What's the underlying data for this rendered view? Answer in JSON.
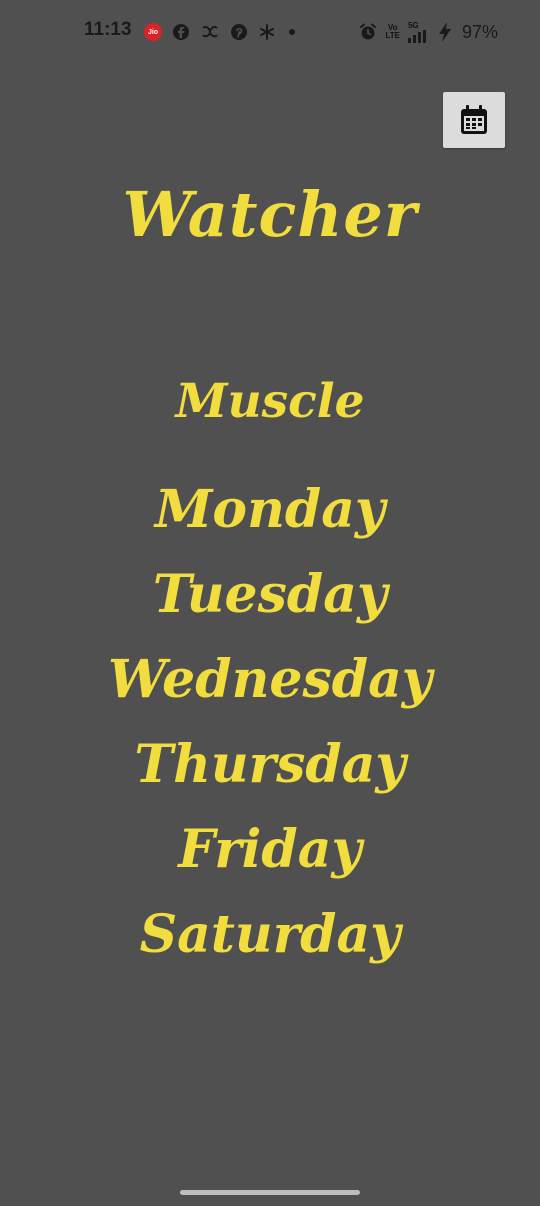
{
  "status_bar": {
    "time": "11:13",
    "jio_label": "Jio",
    "net_top": "Vo",
    "net_bottom": "LTE",
    "net_gen": "5G",
    "battery": "97%",
    "icons": [
      "jio-icon",
      "facebook-icon",
      "app-icon",
      "pinterest-icon",
      "spark-icon",
      "dot-icon",
      "alarm-icon",
      "volte-icon",
      "signal-icon",
      "charging-icon"
    ]
  },
  "toolbar": {
    "calendar_icon": "calendar-icon"
  },
  "app": {
    "title": "Watcher",
    "workout": "Muscle"
  },
  "days": [
    "Monday",
    "Tuesday",
    "Wednesday",
    "Thursday",
    "Friday",
    "Saturday"
  ],
  "colors": {
    "background": "#505050",
    "text_accent": "#f2dd3e",
    "button_bg": "#dcdcdc"
  }
}
